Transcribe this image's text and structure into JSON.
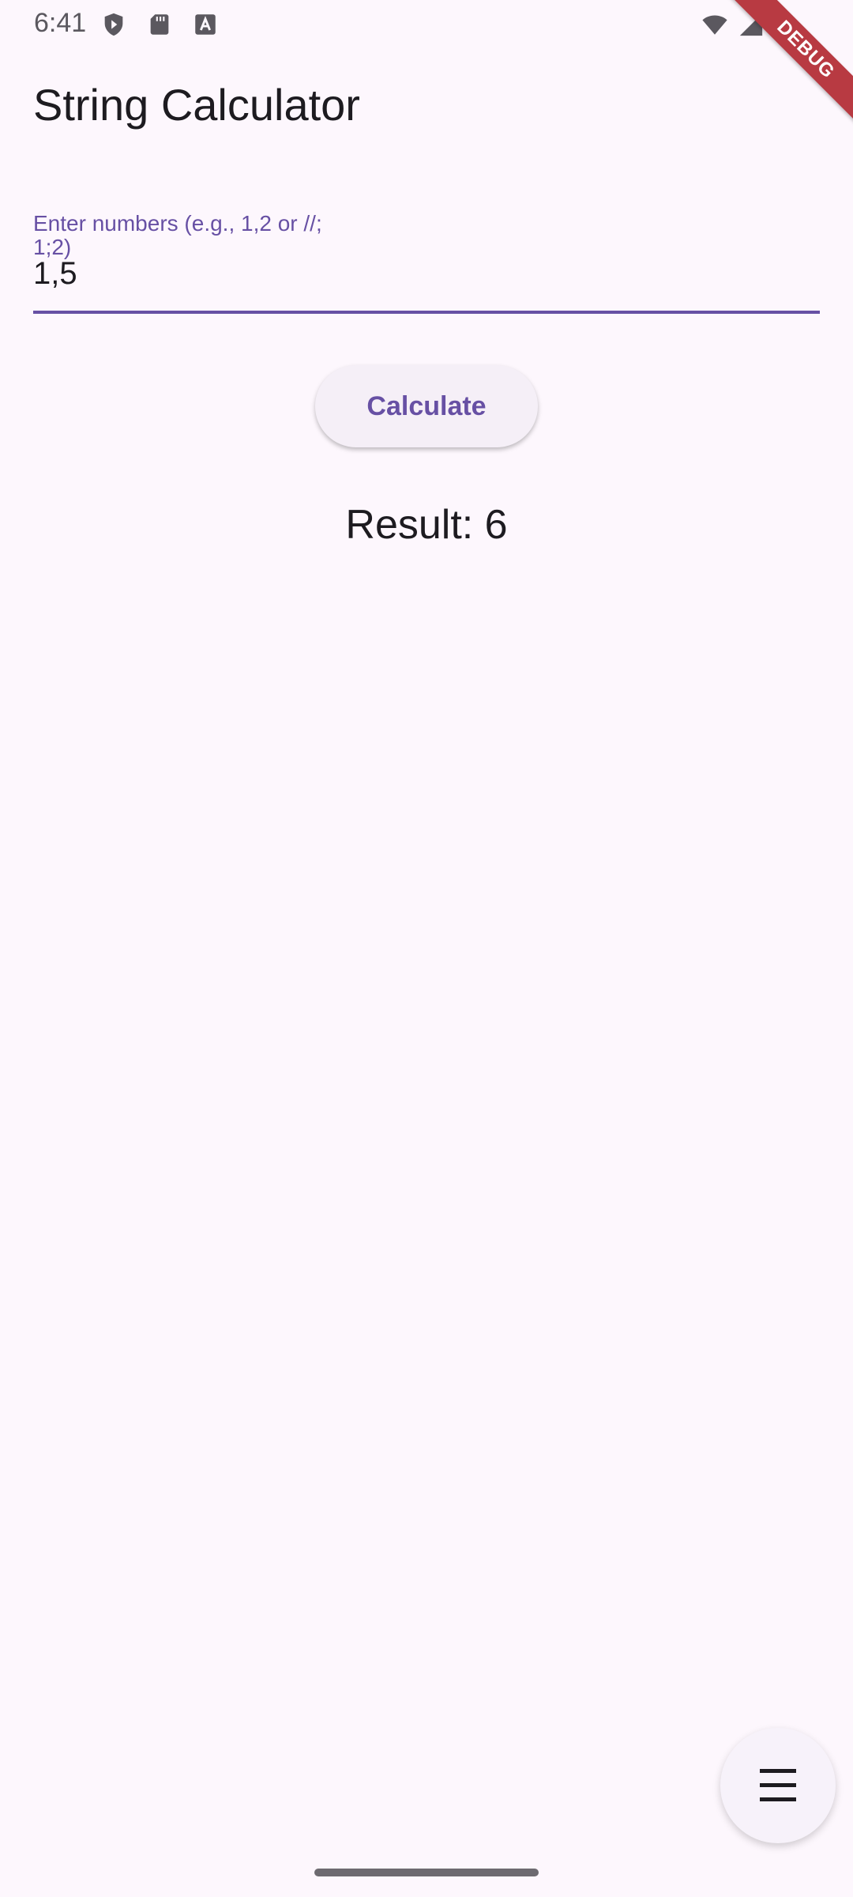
{
  "status_bar": {
    "time": "6:41",
    "left_icons": [
      "shield-play-icon",
      "sd-card-icon",
      "font-a-icon"
    ],
    "right_icons": [
      "wifi-icon",
      "cellular-signal-icon",
      "battery-icon"
    ]
  },
  "debug_banner": {
    "label": "DEBUG",
    "color": "#b83a42"
  },
  "app_bar": {
    "title": "String Calculator"
  },
  "input": {
    "label": "Enter numbers (e.g., 1,2 or //;\n1;2)",
    "value": "1,5"
  },
  "calculate_button": {
    "label": "Calculate"
  },
  "result": {
    "text": "Result: 6"
  },
  "fab": {
    "icon": "menu-icon"
  },
  "colors": {
    "background": "#fdf7fd",
    "primary": "#6750a4",
    "button_bg": "#f5eff7"
  }
}
